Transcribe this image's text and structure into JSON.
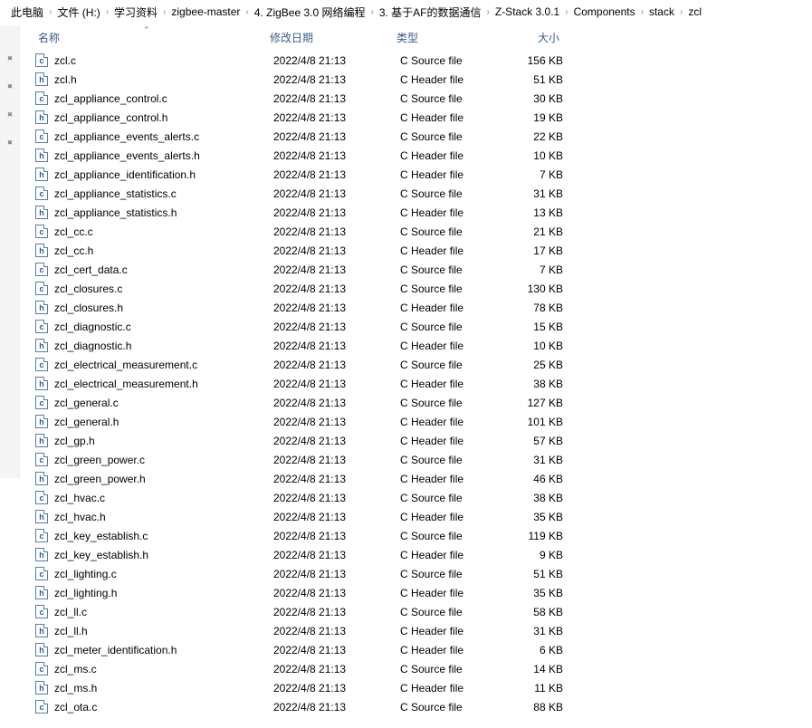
{
  "breadcrumb": [
    "此电脑",
    "文件 (H:)",
    "学习资料",
    "zigbee-master",
    "4. ZigBee 3.0 网络编程",
    "3. 基于AF的数据通信",
    "Z-Stack 3.0.1",
    "Components",
    "stack",
    "zcl"
  ],
  "columns": {
    "name": "名称",
    "date": "修改日期",
    "type": "类型",
    "size": "大小"
  },
  "icon_labels": {
    "c": "c",
    "h": "h"
  },
  "type_labels": {
    "c": "C Source file",
    "h": "C Header file"
  },
  "files": [
    {
      "name": "zcl.c",
      "ext": "c",
      "date": "2022/4/8 21:13",
      "type": "c",
      "size": "156 KB"
    },
    {
      "name": "zcl.h",
      "ext": "h",
      "date": "2022/4/8 21:13",
      "type": "h",
      "size": "51 KB"
    },
    {
      "name": "zcl_appliance_control.c",
      "ext": "c",
      "date": "2022/4/8 21:13",
      "type": "c",
      "size": "30 KB"
    },
    {
      "name": "zcl_appliance_control.h",
      "ext": "h",
      "date": "2022/4/8 21:13",
      "type": "h",
      "size": "19 KB"
    },
    {
      "name": "zcl_appliance_events_alerts.c",
      "ext": "c",
      "date": "2022/4/8 21:13",
      "type": "c",
      "size": "22 KB"
    },
    {
      "name": "zcl_appliance_events_alerts.h",
      "ext": "h",
      "date": "2022/4/8 21:13",
      "type": "h",
      "size": "10 KB"
    },
    {
      "name": "zcl_appliance_identification.h",
      "ext": "h",
      "date": "2022/4/8 21:13",
      "type": "h",
      "size": "7 KB"
    },
    {
      "name": "zcl_appliance_statistics.c",
      "ext": "c",
      "date": "2022/4/8 21:13",
      "type": "c",
      "size": "31 KB"
    },
    {
      "name": "zcl_appliance_statistics.h",
      "ext": "h",
      "date": "2022/4/8 21:13",
      "type": "h",
      "size": "13 KB"
    },
    {
      "name": "zcl_cc.c",
      "ext": "c",
      "date": "2022/4/8 21:13",
      "type": "c",
      "size": "21 KB"
    },
    {
      "name": "zcl_cc.h",
      "ext": "h",
      "date": "2022/4/8 21:13",
      "type": "h",
      "size": "17 KB"
    },
    {
      "name": "zcl_cert_data.c",
      "ext": "c",
      "date": "2022/4/8 21:13",
      "type": "c",
      "size": "7 KB"
    },
    {
      "name": "zcl_closures.c",
      "ext": "c",
      "date": "2022/4/8 21:13",
      "type": "c",
      "size": "130 KB"
    },
    {
      "name": "zcl_closures.h",
      "ext": "h",
      "date": "2022/4/8 21:13",
      "type": "h",
      "size": "78 KB"
    },
    {
      "name": "zcl_diagnostic.c",
      "ext": "c",
      "date": "2022/4/8 21:13",
      "type": "c",
      "size": "15 KB"
    },
    {
      "name": "zcl_diagnostic.h",
      "ext": "h",
      "date": "2022/4/8 21:13",
      "type": "h",
      "size": "10 KB"
    },
    {
      "name": "zcl_electrical_measurement.c",
      "ext": "c",
      "date": "2022/4/8 21:13",
      "type": "c",
      "size": "25 KB"
    },
    {
      "name": "zcl_electrical_measurement.h",
      "ext": "h",
      "date": "2022/4/8 21:13",
      "type": "h",
      "size": "38 KB"
    },
    {
      "name": "zcl_general.c",
      "ext": "c",
      "date": "2022/4/8 21:13",
      "type": "c",
      "size": "127 KB"
    },
    {
      "name": "zcl_general.h",
      "ext": "h",
      "date": "2022/4/8 21:13",
      "type": "h",
      "size": "101 KB"
    },
    {
      "name": "zcl_gp.h",
      "ext": "h",
      "date": "2022/4/8 21:13",
      "type": "h",
      "size": "57 KB"
    },
    {
      "name": "zcl_green_power.c",
      "ext": "c",
      "date": "2022/4/8 21:13",
      "type": "c",
      "size": "31 KB"
    },
    {
      "name": "zcl_green_power.h",
      "ext": "h",
      "date": "2022/4/8 21:13",
      "type": "h",
      "size": "46 KB"
    },
    {
      "name": "zcl_hvac.c",
      "ext": "c",
      "date": "2022/4/8 21:13",
      "type": "c",
      "size": "38 KB"
    },
    {
      "name": "zcl_hvac.h",
      "ext": "h",
      "date": "2022/4/8 21:13",
      "type": "h",
      "size": "35 KB"
    },
    {
      "name": "zcl_key_establish.c",
      "ext": "c",
      "date": "2022/4/8 21:13",
      "type": "c",
      "size": "119 KB"
    },
    {
      "name": "zcl_key_establish.h",
      "ext": "h",
      "date": "2022/4/8 21:13",
      "type": "h",
      "size": "9 KB"
    },
    {
      "name": "zcl_lighting.c",
      "ext": "c",
      "date": "2022/4/8 21:13",
      "type": "c",
      "size": "51 KB"
    },
    {
      "name": "zcl_lighting.h",
      "ext": "h",
      "date": "2022/4/8 21:13",
      "type": "h",
      "size": "35 KB"
    },
    {
      "name": "zcl_ll.c",
      "ext": "c",
      "date": "2022/4/8 21:13",
      "type": "c",
      "size": "58 KB"
    },
    {
      "name": "zcl_ll.h",
      "ext": "h",
      "date": "2022/4/8 21:13",
      "type": "h",
      "size": "31 KB"
    },
    {
      "name": "zcl_meter_identification.h",
      "ext": "h",
      "date": "2022/4/8 21:13",
      "type": "h",
      "size": "6 KB"
    },
    {
      "name": "zcl_ms.c",
      "ext": "c",
      "date": "2022/4/8 21:13",
      "type": "c",
      "size": "14 KB"
    },
    {
      "name": "zcl_ms.h",
      "ext": "h",
      "date": "2022/4/8 21:13",
      "type": "h",
      "size": "11 KB"
    },
    {
      "name": "zcl_ota.c",
      "ext": "c",
      "date": "2022/4/8 21:13",
      "type": "c",
      "size": "88 KB"
    }
  ]
}
